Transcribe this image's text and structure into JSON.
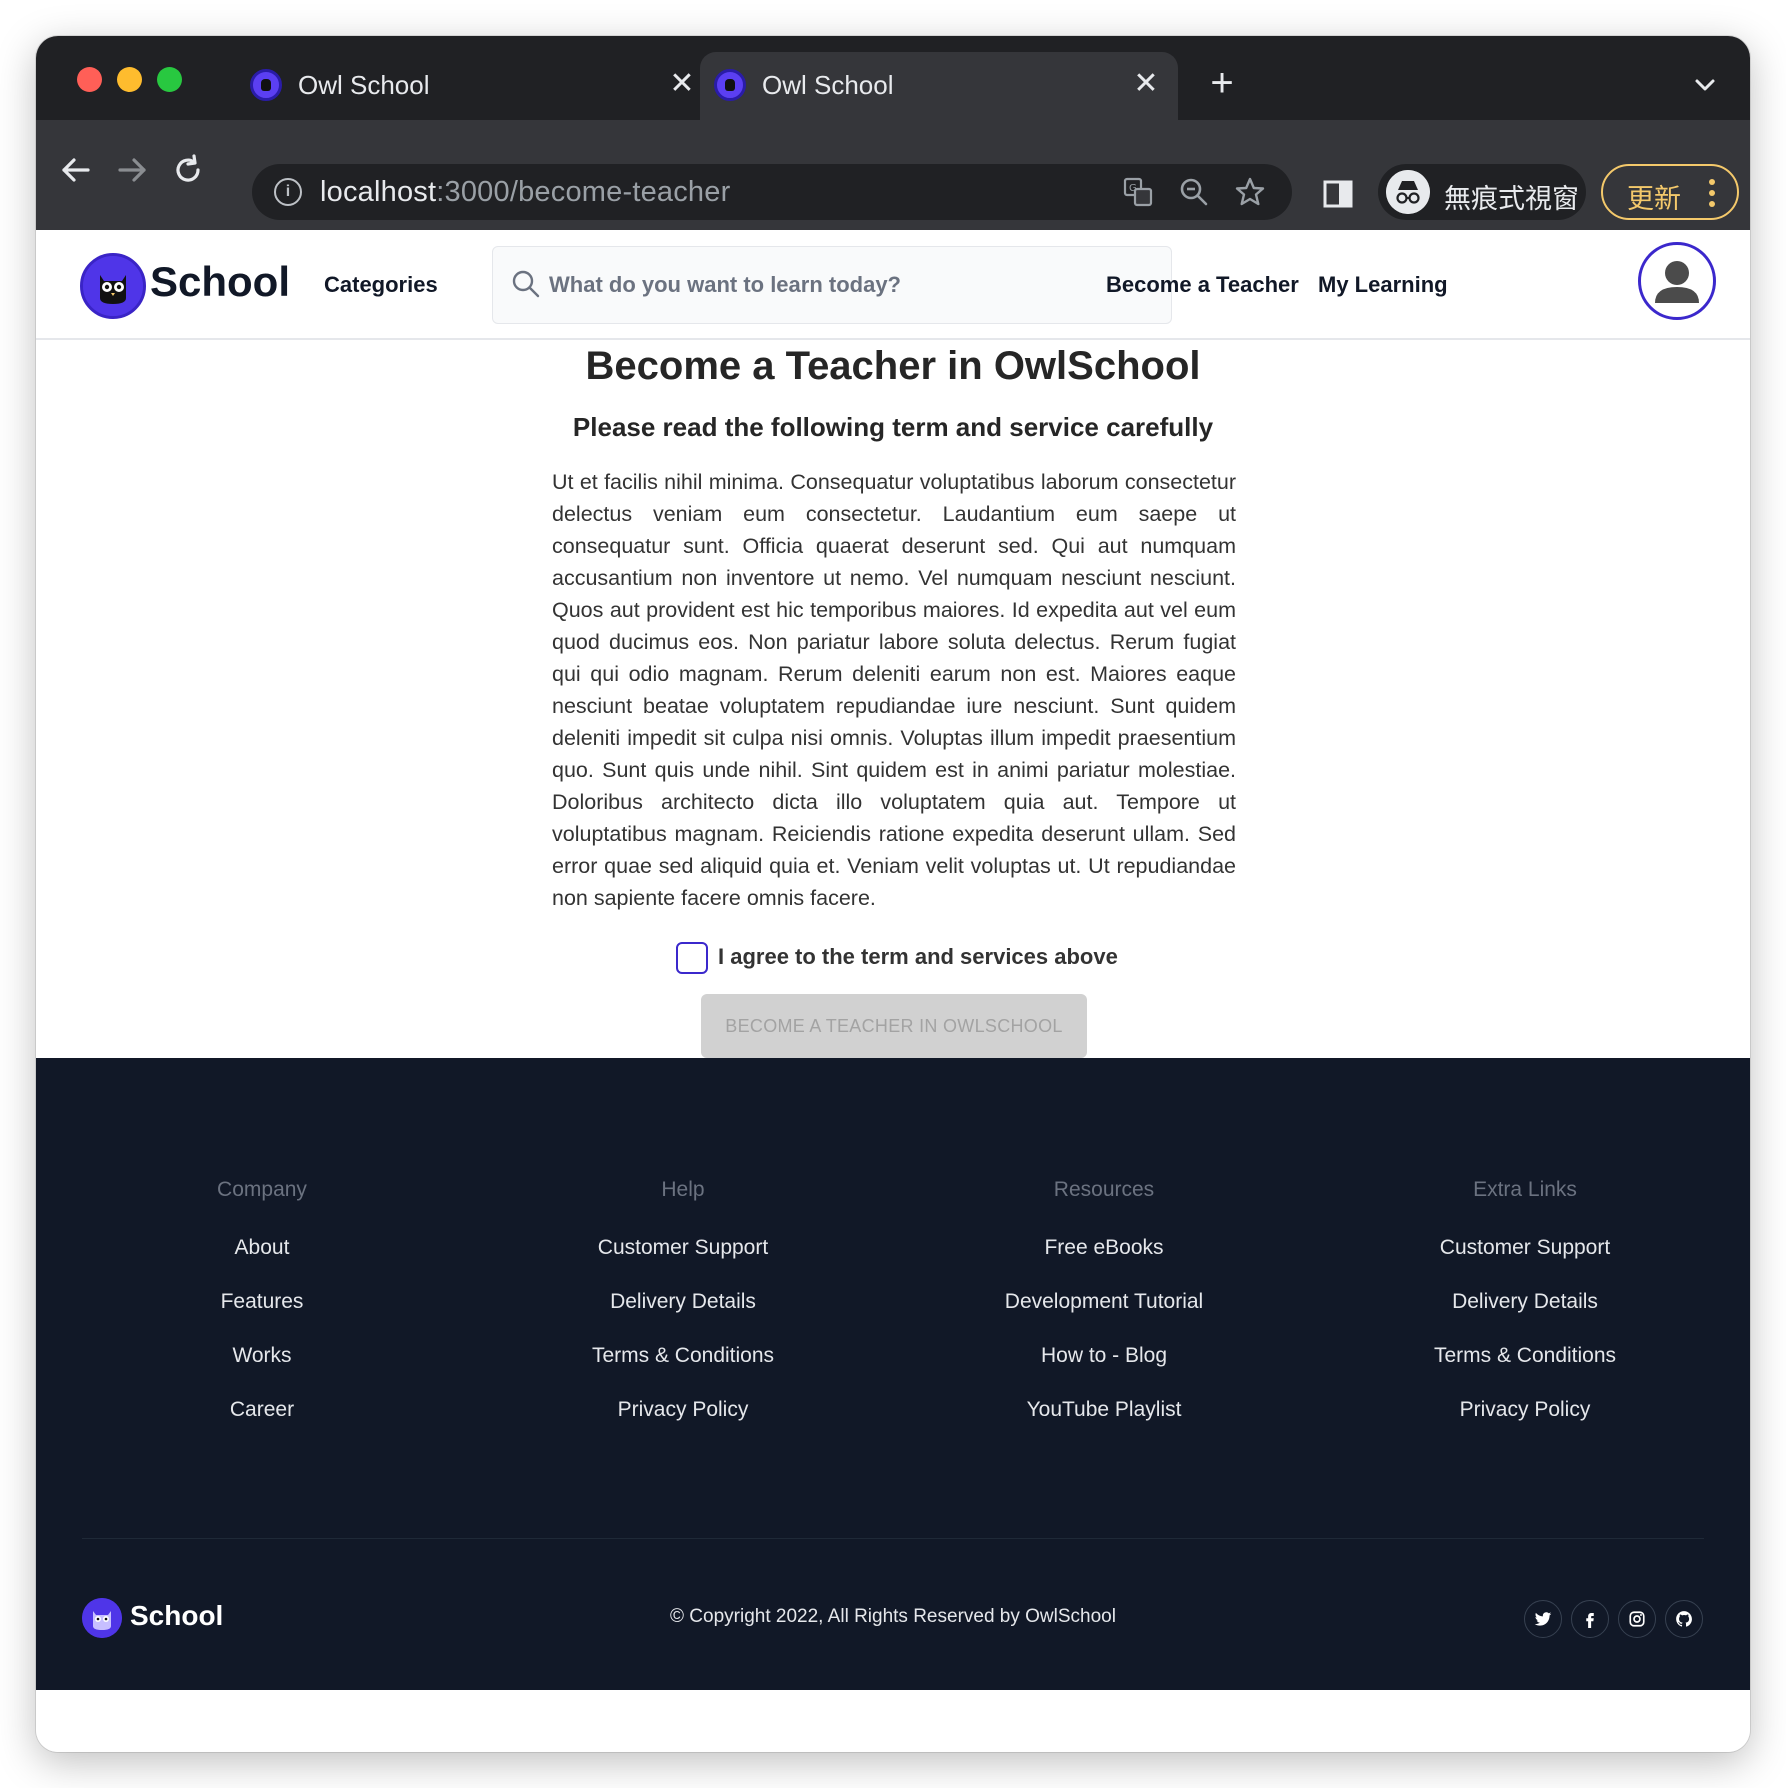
{
  "browser": {
    "tabs": [
      {
        "title": "Owl School",
        "active": false
      },
      {
        "title": "Owl School",
        "active": true
      }
    ],
    "url_host": "localhost",
    "url_path": ":3000/become-teacher",
    "incognito_label": "無痕式視窗",
    "update_label": "更新"
  },
  "header": {
    "logo_text": "School",
    "categories": "Categories",
    "search_placeholder": "What do you want to learn today?",
    "become_teacher": "Become a Teacher",
    "my_learning": "My Learning"
  },
  "main": {
    "title": "Become a Teacher in OwlSchool",
    "subtitle": "Please read the following term and service carefully",
    "terms_text": "Ut et facilis nihil minima. Consequatur voluptatibus laborum consectetur delectus veniam eum consectetur. Laudantium eum saepe ut consequatur sunt. Officia quaerat deserunt sed. Qui aut numquam accusantium non inventore ut nemo. Vel numquam nesciunt nesciunt. Quos aut provident est hic temporibus maiores. Id expedita aut vel eum quod ducimus eos. Non pariatur labore soluta delectus. Rerum fugiat qui qui odio magnam. Rerum deleniti earum non est. Maiores eaque nesciunt beatae voluptatem repudiandae iure nesciunt. Sunt quidem deleniti impedit sit culpa nisi omnis. Voluptas illum impedit praesentium quo. Sunt quis unde nihil. Sint quidem est in animi pariatur molestiae. Doloribus architecto dicta illo voluptatem quia aut. Tempore ut voluptatibus magnam. Reiciendis ratione expedita deserunt ullam. Sed error quae sed aliquid quia et. Veniam velit voluptas ut. Ut repudiandae non sapiente facere omnis facere.",
    "agree_label": "I agree to the term and services above",
    "agree_checked": false,
    "submit_label": "BECOME A TEACHER IN OWLSCHOOL",
    "submit_disabled": true
  },
  "footer": {
    "columns": [
      {
        "heading": "Company",
        "links": [
          "About",
          "Features",
          "Works",
          "Career"
        ]
      },
      {
        "heading": "Help",
        "links": [
          "Customer Support",
          "Delivery Details",
          "Terms & Conditions",
          "Privacy Policy"
        ]
      },
      {
        "heading": "Resources",
        "links": [
          "Free eBooks",
          "Development Tutorial",
          "How to - Blog",
          "YouTube Playlist"
        ]
      },
      {
        "heading": "Extra Links",
        "links": [
          "Customer Support",
          "Delivery Details",
          "Terms & Conditions",
          "Privacy Policy"
        ]
      }
    ],
    "logo_text": "School",
    "copyright": "© Copyright 2022, All Rights Reserved by OwlSchool",
    "social_icons": [
      "twitter-icon",
      "facebook-icon",
      "instagram-icon",
      "github-icon"
    ]
  },
  "colors": {
    "brand": "#4f35e8",
    "footer_bg": "#111827",
    "chrome_dark": "#202124",
    "chrome_toolbar": "#35363a"
  }
}
